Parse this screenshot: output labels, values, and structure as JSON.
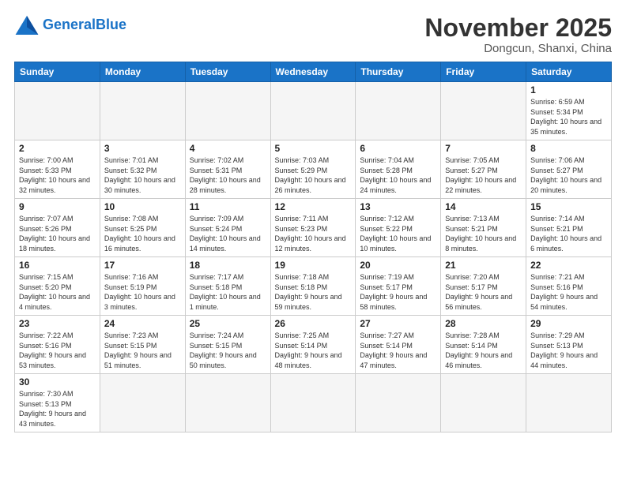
{
  "logo": {
    "text_general": "General",
    "text_blue": "Blue"
  },
  "title": "November 2025",
  "location": "Dongcun, Shanxi, China",
  "weekdays": [
    "Sunday",
    "Monday",
    "Tuesday",
    "Wednesday",
    "Thursday",
    "Friday",
    "Saturday"
  ],
  "weeks": [
    [
      {
        "day": "",
        "info": ""
      },
      {
        "day": "",
        "info": ""
      },
      {
        "day": "",
        "info": ""
      },
      {
        "day": "",
        "info": ""
      },
      {
        "day": "",
        "info": ""
      },
      {
        "day": "",
        "info": ""
      },
      {
        "day": "1",
        "info": "Sunrise: 6:59 AM\nSunset: 5:34 PM\nDaylight: 10 hours and 35 minutes."
      }
    ],
    [
      {
        "day": "2",
        "info": "Sunrise: 7:00 AM\nSunset: 5:33 PM\nDaylight: 10 hours and 32 minutes."
      },
      {
        "day": "3",
        "info": "Sunrise: 7:01 AM\nSunset: 5:32 PM\nDaylight: 10 hours and 30 minutes."
      },
      {
        "day": "4",
        "info": "Sunrise: 7:02 AM\nSunset: 5:31 PM\nDaylight: 10 hours and 28 minutes."
      },
      {
        "day": "5",
        "info": "Sunrise: 7:03 AM\nSunset: 5:29 PM\nDaylight: 10 hours and 26 minutes."
      },
      {
        "day": "6",
        "info": "Sunrise: 7:04 AM\nSunset: 5:28 PM\nDaylight: 10 hours and 24 minutes."
      },
      {
        "day": "7",
        "info": "Sunrise: 7:05 AM\nSunset: 5:27 PM\nDaylight: 10 hours and 22 minutes."
      },
      {
        "day": "8",
        "info": "Sunrise: 7:06 AM\nSunset: 5:27 PM\nDaylight: 10 hours and 20 minutes."
      }
    ],
    [
      {
        "day": "9",
        "info": "Sunrise: 7:07 AM\nSunset: 5:26 PM\nDaylight: 10 hours and 18 minutes."
      },
      {
        "day": "10",
        "info": "Sunrise: 7:08 AM\nSunset: 5:25 PM\nDaylight: 10 hours and 16 minutes."
      },
      {
        "day": "11",
        "info": "Sunrise: 7:09 AM\nSunset: 5:24 PM\nDaylight: 10 hours and 14 minutes."
      },
      {
        "day": "12",
        "info": "Sunrise: 7:11 AM\nSunset: 5:23 PM\nDaylight: 10 hours and 12 minutes."
      },
      {
        "day": "13",
        "info": "Sunrise: 7:12 AM\nSunset: 5:22 PM\nDaylight: 10 hours and 10 minutes."
      },
      {
        "day": "14",
        "info": "Sunrise: 7:13 AM\nSunset: 5:21 PM\nDaylight: 10 hours and 8 minutes."
      },
      {
        "day": "15",
        "info": "Sunrise: 7:14 AM\nSunset: 5:21 PM\nDaylight: 10 hours and 6 minutes."
      }
    ],
    [
      {
        "day": "16",
        "info": "Sunrise: 7:15 AM\nSunset: 5:20 PM\nDaylight: 10 hours and 4 minutes."
      },
      {
        "day": "17",
        "info": "Sunrise: 7:16 AM\nSunset: 5:19 PM\nDaylight: 10 hours and 3 minutes."
      },
      {
        "day": "18",
        "info": "Sunrise: 7:17 AM\nSunset: 5:18 PM\nDaylight: 10 hours and 1 minute."
      },
      {
        "day": "19",
        "info": "Sunrise: 7:18 AM\nSunset: 5:18 PM\nDaylight: 9 hours and 59 minutes."
      },
      {
        "day": "20",
        "info": "Sunrise: 7:19 AM\nSunset: 5:17 PM\nDaylight: 9 hours and 58 minutes."
      },
      {
        "day": "21",
        "info": "Sunrise: 7:20 AM\nSunset: 5:17 PM\nDaylight: 9 hours and 56 minutes."
      },
      {
        "day": "22",
        "info": "Sunrise: 7:21 AM\nSunset: 5:16 PM\nDaylight: 9 hours and 54 minutes."
      }
    ],
    [
      {
        "day": "23",
        "info": "Sunrise: 7:22 AM\nSunset: 5:16 PM\nDaylight: 9 hours and 53 minutes."
      },
      {
        "day": "24",
        "info": "Sunrise: 7:23 AM\nSunset: 5:15 PM\nDaylight: 9 hours and 51 minutes."
      },
      {
        "day": "25",
        "info": "Sunrise: 7:24 AM\nSunset: 5:15 PM\nDaylight: 9 hours and 50 minutes."
      },
      {
        "day": "26",
        "info": "Sunrise: 7:25 AM\nSunset: 5:14 PM\nDaylight: 9 hours and 48 minutes."
      },
      {
        "day": "27",
        "info": "Sunrise: 7:27 AM\nSunset: 5:14 PM\nDaylight: 9 hours and 47 minutes."
      },
      {
        "day": "28",
        "info": "Sunrise: 7:28 AM\nSunset: 5:14 PM\nDaylight: 9 hours and 46 minutes."
      },
      {
        "day": "29",
        "info": "Sunrise: 7:29 AM\nSunset: 5:13 PM\nDaylight: 9 hours and 44 minutes."
      }
    ],
    [
      {
        "day": "30",
        "info": "Sunrise: 7:30 AM\nSunset: 5:13 PM\nDaylight: 9 hours and 43 minutes."
      },
      {
        "day": "",
        "info": ""
      },
      {
        "day": "",
        "info": ""
      },
      {
        "day": "",
        "info": ""
      },
      {
        "day": "",
        "info": ""
      },
      {
        "day": "",
        "info": ""
      },
      {
        "day": "",
        "info": ""
      }
    ]
  ]
}
